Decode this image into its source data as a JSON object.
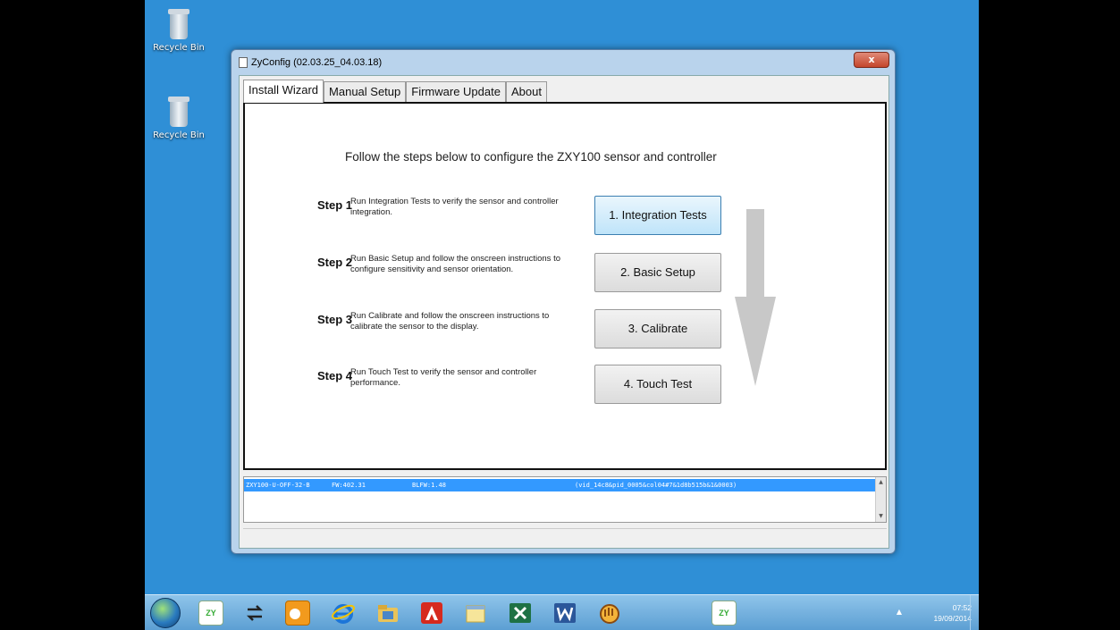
{
  "desktop": {
    "icons": [
      {
        "label": "Recycle Bin",
        "icon": "recycle-bin-full-icon"
      },
      {
        "label": "Recycle Bin",
        "icon": "recycle-bin-empty-icon"
      }
    ]
  },
  "window": {
    "title": "ZyConfig (02.03.25_04.03.18)",
    "close_label": "x",
    "tabs": [
      {
        "label": "Install Wizard",
        "active": true
      },
      {
        "label": "Manual Setup",
        "active": false
      },
      {
        "label": "Firmware Update",
        "active": false
      },
      {
        "label": "About",
        "active": false
      }
    ],
    "instruction": "Follow the steps below to configure the ZXY100 sensor and controller",
    "steps": [
      {
        "label": "Step 1",
        "desc": "Run Integration Tests to verify the sensor and controller integration.",
        "button": "1. Integration Tests"
      },
      {
        "label": "Step 2",
        "desc": "Run Basic Setup and follow the onscreen instructions to configure sensitivity and sensor orientation.",
        "button": "2. Basic Setup"
      },
      {
        "label": "Step 3",
        "desc": "Run Calibrate and follow the onscreen instructions to calibrate the sensor to the display.",
        "button": "3. Calibrate"
      },
      {
        "label": "Step 4",
        "desc": "Run Touch Test to verify the sensor and controller performance.",
        "button": "4. Touch Test"
      }
    ],
    "device": {
      "model": "ZXY100-U-OFF-32-B",
      "fw": "FW:402.31",
      "blfw": "BLFW:1.48",
      "id": "(vid_14c8&pid_0005&col04#7&1d8b515b&1&0003)"
    }
  },
  "taskbar": {
    "items": [
      "start-orb-icon",
      "zyconfig-icon",
      "network-arrows-icon",
      "outlook-icon",
      "internet-explorer-icon",
      "file-explorer-icon",
      "acrobat-icon",
      "notes-icon",
      "excel-icon",
      "word-icon",
      "hand-icon",
      "zyconfig-icon"
    ],
    "tray_arrow": "▲",
    "time": "07:52",
    "date": "19/09/2014"
  },
  "colors": {
    "desktop": "#2f8fd6",
    "selection": "#3399ff",
    "hover_button": "#bfe4f9"
  }
}
